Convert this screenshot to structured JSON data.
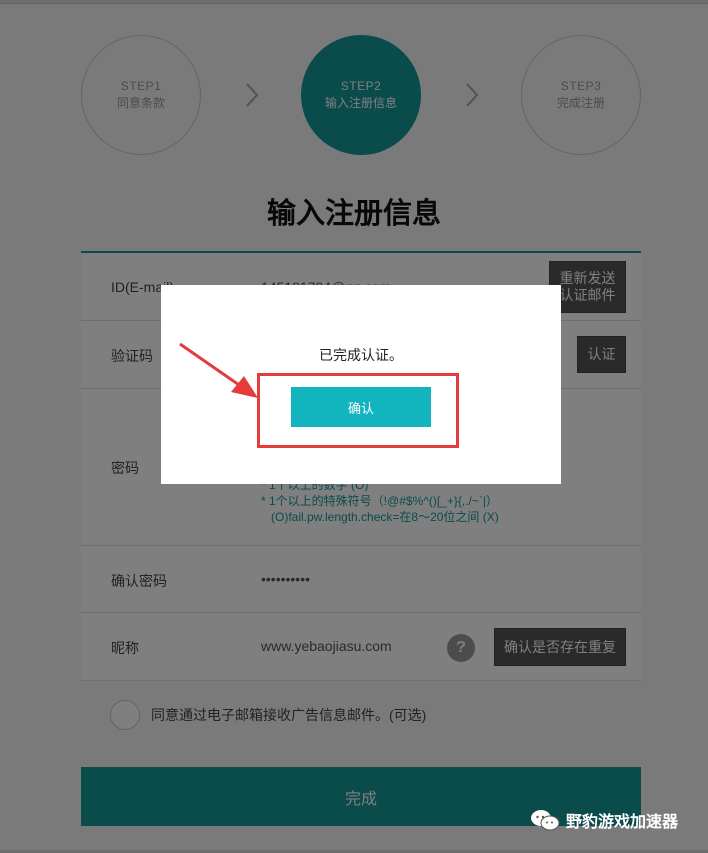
{
  "steps": [
    {
      "num": "STEP1",
      "label": "同意条款"
    },
    {
      "num": "STEP2",
      "label": "输入注册信息"
    },
    {
      "num": "STEP3",
      "label": "完成注册"
    }
  ],
  "page_title": "输入注册信息",
  "form": {
    "id_label": "ID(E-mail)",
    "id_value": "145181794@qq.com",
    "resend_button": "重新发送\n认证邮件",
    "code_label": "验证码",
    "code_button": "认证",
    "password_label": "密码",
    "password_hints": [
      "* 1个以上的数字 (O)",
      "* 1个以上的特殊符号（!@#$%^()[_+}{,./~`|）",
      "(O)fail.pw.length.check=在8～20位之间 (X)"
    ],
    "confirm_label": "确认密码",
    "confirm_value": "••••••••••",
    "nickname_label": "昵称",
    "nickname_value": "www.yebaojiasu.com",
    "help_symbol": "?",
    "check_dup_button": "确认是否存在重复"
  },
  "agree_text": "同意通过电子邮箱接收广告信息邮件。(可选)",
  "finish_button": "完成",
  "modal": {
    "message": "已完成认证。",
    "ok_button": "确认"
  },
  "watermark": "野豹游戏加速器",
  "colors": {
    "accent": "#149799",
    "modal_button": "#12b4bd",
    "highlight": "#e43b3b"
  }
}
